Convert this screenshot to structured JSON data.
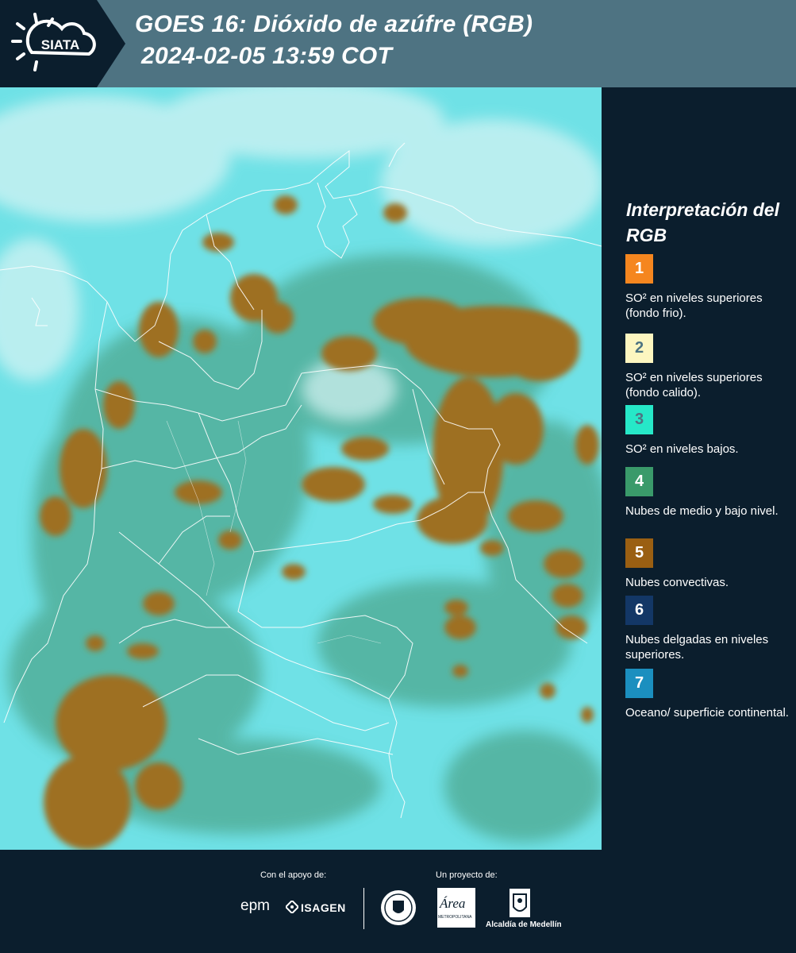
{
  "header": {
    "logo_text": "SIATA",
    "title_line1": "GOES 16: Dióxido de azúfre (RGB)",
    "title_line2": "2024-02-05 13:59 COT"
  },
  "legend": {
    "title": "Interpretación del RGB",
    "items": [
      {
        "number": "1",
        "color": "#f5861f",
        "number_color": "#ffffff",
        "text": "SO² en niveles superiores (fondo frio)."
      },
      {
        "number": "2",
        "color": "#fdf6c0",
        "number_color": "#4e7382",
        "text": "SO² en niveles superiores (fondo calido)."
      },
      {
        "number": "3",
        "color": "#26e8c8",
        "number_color": "#4e7382",
        "text": "SO² en niveles bajos."
      },
      {
        "number": "4",
        "color": "#3a9a6a",
        "number_color": "#ffffff",
        "text": "Nubes de medio y bajo nivel."
      },
      {
        "number": "5",
        "color": "#9a5f12",
        "number_color": "#ffffff",
        "text": "Nubes convectivas."
      },
      {
        "number": "6",
        "color": "#133766",
        "number_color": "#ffffff",
        "text": "Nubes delgadas en niveles superiores."
      },
      {
        "number": "7",
        "color": "#1b8fbf",
        "number_color": "#ffffff",
        "text": "Oceano/ superficie continental."
      }
    ]
  },
  "footer": {
    "support_caption": "Con el apoyo de:",
    "project_caption": "Un proyecto de:",
    "sponsor_epm": "epm",
    "sponsor_isagen": "ISAGEN",
    "partner_area": "Área",
    "partner_area_sub": "METROPOLITANA",
    "partner_alcaldia": "Alcaldía de Medellín"
  },
  "colors": {
    "header_bg": "#4e7382",
    "panel_bg": "#0b1e2d",
    "map_background": "#6de0e4",
    "convective_clouds": "#9a6c22",
    "low_clouds": "#3e9a72"
  }
}
